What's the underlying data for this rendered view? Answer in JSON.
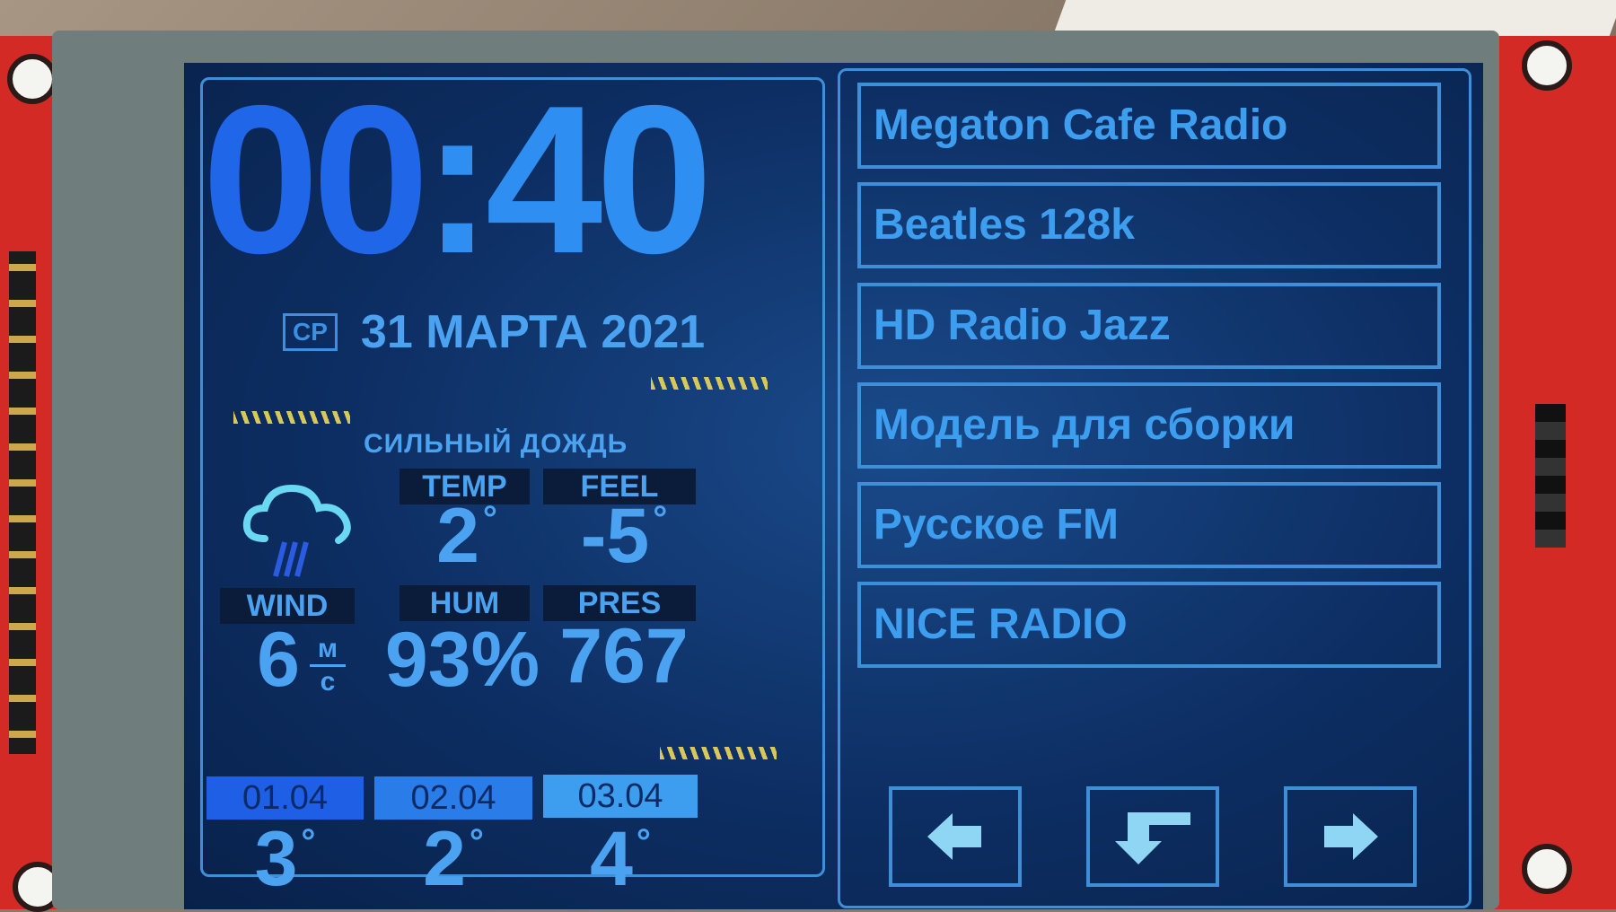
{
  "clock": {
    "hours": "00",
    "sep": ":",
    "minutes": "40"
  },
  "date": {
    "weekday": "СР",
    "text": "31 МАРТА 2021"
  },
  "weather": {
    "condition": "СИЛЬНЫЙ ДОЖДЬ",
    "icon": "cloud-rain-icon",
    "temp": {
      "label": "TEMP",
      "value": "2",
      "unit": "°"
    },
    "feel": {
      "label": "FEEL",
      "value": "-5",
      "unit": "°"
    },
    "wind": {
      "label": "WIND",
      "value": "6",
      "unit_top": "м",
      "unit_bottom": "с"
    },
    "hum": {
      "label": "HUM",
      "value": "93%"
    },
    "pres": {
      "label": "PRES",
      "value": "767"
    }
  },
  "forecast": [
    {
      "date": "01.04",
      "temp": "3",
      "unit": "°",
      "color": "#1f5fe6"
    },
    {
      "date": "02.04",
      "temp": "2",
      "unit": "°",
      "color": "#2a7de8"
    },
    {
      "date": "03.04",
      "temp": "4",
      "unit": "°",
      "color": "#3d9ef0"
    }
  ],
  "stations": [
    "Megaton Cafe Radio",
    "Beatles 128k",
    "HD Radio Jazz",
    "Модель для сборки",
    "Русское FM",
    "NICE RADIO"
  ],
  "nav": {
    "prev_icon": "arrow-left-icon",
    "back_icon": "return-icon",
    "next_icon": "arrow-right-icon"
  },
  "colors": {
    "accent": "#3e8fd8",
    "text": "#4aa2f0",
    "background": "#0d2e63"
  }
}
